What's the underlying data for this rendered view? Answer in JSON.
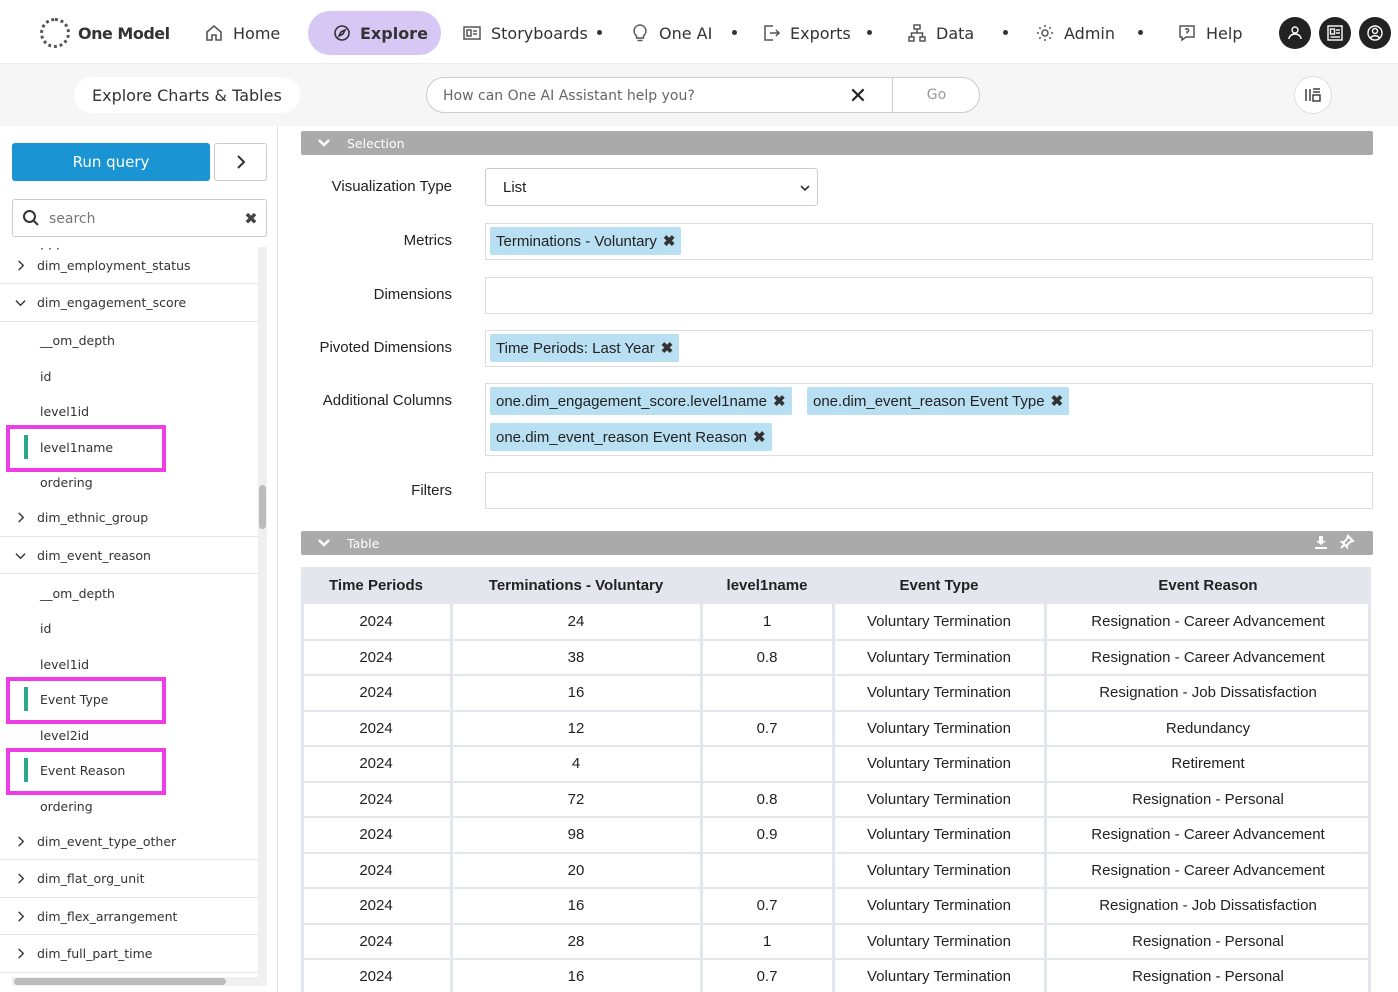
{
  "app": {
    "logo_text": "One Model"
  },
  "nav": {
    "items": [
      {
        "label": "Home",
        "icon": "home-icon"
      },
      {
        "label": "Explore",
        "icon": "explore-icon",
        "active": true
      },
      {
        "label": "Storyboards",
        "icon": "storyboard-icon"
      },
      {
        "label": "One AI",
        "icon": "lightbulb-icon"
      },
      {
        "label": "Exports",
        "icon": "export-icon"
      },
      {
        "label": "Data",
        "icon": "data-icon"
      },
      {
        "label": "Admin",
        "icon": "gear-icon"
      },
      {
        "label": "Help",
        "icon": "help-icon"
      }
    ],
    "accent_color": "#d7c7f4"
  },
  "subbar": {
    "page_title": "Explore Charts & Tables",
    "assistant_placeholder": "How can One AI Assistant help you?",
    "assistant_go": "Go",
    "clear_symbol": "✕"
  },
  "left": {
    "run_query": "Run query",
    "search_placeholder": "search",
    "search_clear": "✖",
    "run_color": "#1b94d3",
    "tree": [
      {
        "type": "parent",
        "label": "dim_employment_status",
        "expanded": false
      },
      {
        "type": "parent",
        "label": "dim_engagement_score",
        "expanded": true
      },
      {
        "type": "child",
        "label": "__om_depth"
      },
      {
        "type": "child",
        "label": "id"
      },
      {
        "type": "child",
        "label": "level1id"
      },
      {
        "type": "child",
        "label": "level1name",
        "selected": true
      },
      {
        "type": "child",
        "label": "ordering"
      },
      {
        "type": "parent",
        "label": "dim_ethnic_group",
        "expanded": false
      },
      {
        "type": "parent",
        "label": "dim_event_reason",
        "expanded": true
      },
      {
        "type": "child",
        "label": "__om_depth"
      },
      {
        "type": "child",
        "label": "id"
      },
      {
        "type": "child",
        "label": "level1id"
      },
      {
        "type": "child",
        "label": "Event Type",
        "selected": true
      },
      {
        "type": "child",
        "label": "level2id"
      },
      {
        "type": "child",
        "label": "Event Reason",
        "selected": true
      },
      {
        "type": "child",
        "label": "ordering"
      },
      {
        "type": "parent",
        "label": "dim_event_type_other",
        "expanded": false
      },
      {
        "type": "parent",
        "label": "dim_flat_org_unit",
        "expanded": false
      },
      {
        "type": "parent",
        "label": "dim_flex_arrangement",
        "expanded": false
      },
      {
        "type": "parent",
        "label": "dim_full_part_time",
        "expanded": false
      }
    ]
  },
  "selection": {
    "header": "Selection",
    "visualization_label": "Visualization Type",
    "visualization_value": "List",
    "metrics_label": "Metrics",
    "metrics": [
      "Terminations - Voluntary"
    ],
    "dimensions_label": "Dimensions",
    "pivoted_label": "Pivoted Dimensions",
    "pivoted": [
      "Time Periods: Last Year"
    ],
    "additional_label": "Additional Columns",
    "additional": [
      "one.dim_engagement_score.level1name",
      "one.dim_event_reason Event Type",
      "one.dim_event_reason Event Reason"
    ],
    "filters_label": "Filters",
    "chip_remove": "✖",
    "chip_color": "#b9dff3"
  },
  "table": {
    "header": "Table",
    "columns": [
      "Time Periods",
      "Terminations - Voluntary",
      "level1name",
      "Event Type",
      "Event Reason"
    ],
    "rows": [
      [
        "2024",
        "24",
        "1",
        "Voluntary Termination",
        "Resignation - Career Advancement"
      ],
      [
        "2024",
        "38",
        "0.8",
        "Voluntary Termination",
        "Resignation - Career Advancement"
      ],
      [
        "2024",
        "16",
        "",
        "Voluntary Termination",
        "Resignation - Job Dissatisfaction"
      ],
      [
        "2024",
        "12",
        "0.7",
        "Voluntary Termination",
        "Redundancy"
      ],
      [
        "2024",
        "4",
        "",
        "Voluntary Termination",
        "Retirement"
      ],
      [
        "2024",
        "72",
        "0.8",
        "Voluntary Termination",
        "Resignation - Personal"
      ],
      [
        "2024",
        "98",
        "0.9",
        "Voluntary Termination",
        "Resignation - Career Advancement"
      ],
      [
        "2024",
        "20",
        "",
        "Voluntary Termination",
        "Resignation - Career Advancement"
      ],
      [
        "2024",
        "16",
        "0.7",
        "Voluntary Termination",
        "Resignation - Job Dissatisfaction"
      ],
      [
        "2024",
        "28",
        "1",
        "Voluntary Termination",
        "Resignation - Personal"
      ],
      [
        "2024",
        "16",
        "0.7",
        "Voluntary Termination",
        "Resignation - Personal"
      ]
    ]
  }
}
